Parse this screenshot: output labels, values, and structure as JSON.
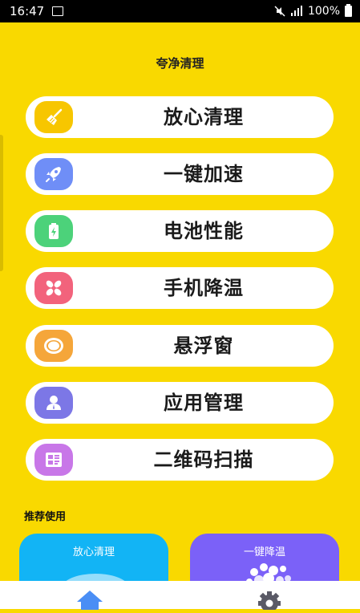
{
  "status_bar": {
    "time": "16:47",
    "battery": "100%"
  },
  "app": {
    "title": "夸净清理"
  },
  "menu": [
    {
      "label": "放心清理",
      "icon": "broom-icon",
      "color": "#F7C600"
    },
    {
      "label": "一键加速",
      "icon": "rocket-icon",
      "color": "#6F8EF7"
    },
    {
      "label": "电池性能",
      "icon": "battery-icon",
      "color": "#4CD27A"
    },
    {
      "label": "手机降温",
      "icon": "fan-icon",
      "color": "#F2637C"
    },
    {
      "label": "悬浮窗",
      "icon": "bubble-icon",
      "color": "#F5A63A"
    },
    {
      "label": "应用管理",
      "icon": "user-icon",
      "color": "#7C77E6"
    },
    {
      "label": "二维码扫描",
      "icon": "qrcode-icon",
      "color": "#C877E8"
    }
  ],
  "recommend": {
    "title": "推荐使用",
    "cards": [
      {
        "label": "放心清理",
        "color": "#12B4F5"
      },
      {
        "label": "一键降温",
        "color": "#7B61F8"
      }
    ]
  },
  "nav": {
    "items": [
      "home-icon",
      "settings-icon"
    ]
  }
}
